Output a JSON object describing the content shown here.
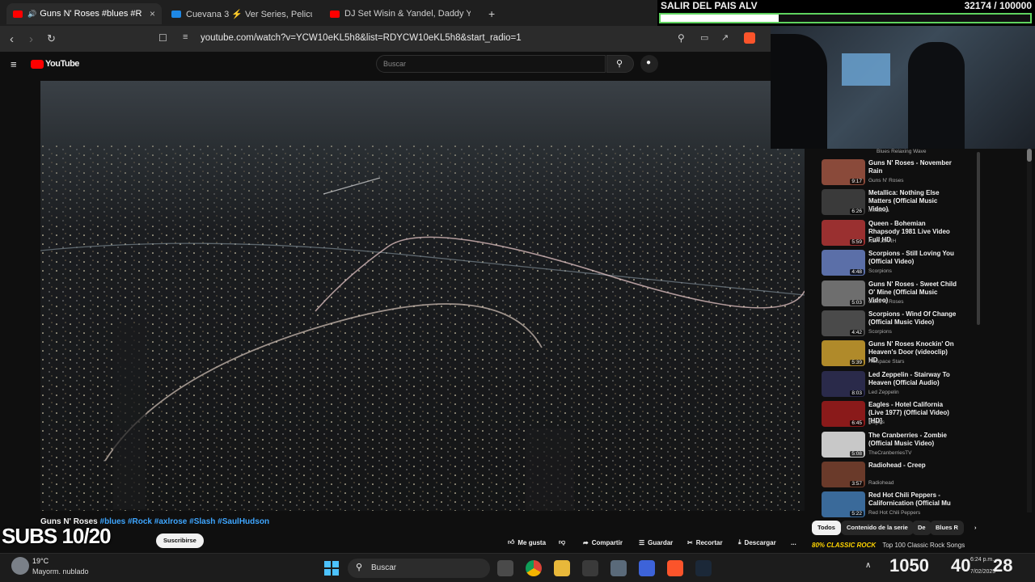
{
  "tabs": [
    {
      "title": "Guns N' Roses #blues #Rock",
      "close": "×"
    },
    {
      "title": "Cuevana 3 ⚡ Ver Series, Pelicula"
    },
    {
      "title": "DJ Set Wisin & Yandel, Daddy Yanke"
    }
  ],
  "new_tab": "+",
  "url": "youtube.com/watch?v=YCW10eKL5h8&list=RDYCW10eKL5h8&start_radio=1",
  "youtube": {
    "logo": "YouTube",
    "search_placeholder": "Buscar"
  },
  "goal": {
    "label": "SALIR DEL PAIS ALV",
    "count": "32174 / 100000",
    "progress": 0.32
  },
  "video": {
    "title_plain": "Guns N' Roses",
    "title_tags": "#blues #Rock #axlrose #Slash #SaulHudson",
    "subscribe": "Suscribirse",
    "actions": [
      "Me gusta",
      "Compartir",
      "Guardar",
      "Recortar",
      "Descargar"
    ],
    "more": "..."
  },
  "overlay": {
    "subs": "SUBS 10/20"
  },
  "playlist_header": "Blues Relaxing Wave",
  "playlist": [
    {
      "title": "Guns N' Roses - November Rain",
      "channel": "Guns N' Roses",
      "duration": "9:17",
      "color": "#8a4a3a"
    },
    {
      "title": "Metallica: Nothing Else Matters (Official Music Video)",
      "channel": "Metallica",
      "duration": "6:26",
      "color": "#3a3a3a"
    },
    {
      "title": "Queen - Bohemian Rhapsody 1981 Live Video Full HD",
      "channel": "NEA ZIXNH",
      "duration": "5:59",
      "color": "#9a3030"
    },
    {
      "title": "Scorpions - Still Loving You (Official Video)",
      "channel": "Scorpions",
      "duration": "4:48",
      "color": "#5b6fa8"
    },
    {
      "title": "Guns N' Roses - Sweet Child O' Mine (Official Music Video)",
      "channel": "Guns N' Roses",
      "duration": "5:03",
      "color": "#6e6e6e"
    },
    {
      "title": "Scorpions - Wind Of Change (Official Music Video)",
      "channel": "Scorpions",
      "duration": "4:42",
      "color": "#4a4a4a"
    },
    {
      "title": "Guns N' Roses Knockin' On Heaven's Door (videoclip) HD",
      "channel": "Hotspace Stars",
      "duration": "5:39",
      "color": "#b08a2a"
    },
    {
      "title": "Led Zeppelin - Stairway To Heaven (Official Audio)",
      "channel": "Led Zeppelin",
      "duration": "8:03",
      "color": "#2a2a4a"
    },
    {
      "title": "Eagles - Hotel California (Live 1977) (Official Video) [HD]",
      "channel": "Eagles",
      "duration": "6:45",
      "color": "#8a1a1a"
    },
    {
      "title": "The Cranberries - Zombie (Official Music Video)",
      "channel": "TheCranberriesTV",
      "duration": "5:08",
      "color": "#c8c8c8"
    },
    {
      "title": "Radiohead - Creep",
      "channel": "Radiohead",
      "duration": "3:57",
      "color": "#6a3a2a"
    },
    {
      "title": "Red Hot Chili Peppers - Californication (Official Mu",
      "channel": "Red Hot Chili Peppers",
      "duration": "5:22",
      "color": "#3a6a9a"
    }
  ],
  "chips": [
    "Todos",
    "Contenido de la serie",
    "De",
    "Blues R"
  ],
  "ticker": {
    "brand": "80% CLASSIC ROCK",
    "text": "Top 100 Classic Rock Songs"
  },
  "taskbar": {
    "weather_temp": "19°C",
    "weather_desc": "Mayorm. nublado",
    "search": "Buscar"
  },
  "clock": {
    "a": "1050",
    "b": "40",
    "c": "28",
    "time": "6:24 p.m.",
    "date": "7/02/2025"
  }
}
